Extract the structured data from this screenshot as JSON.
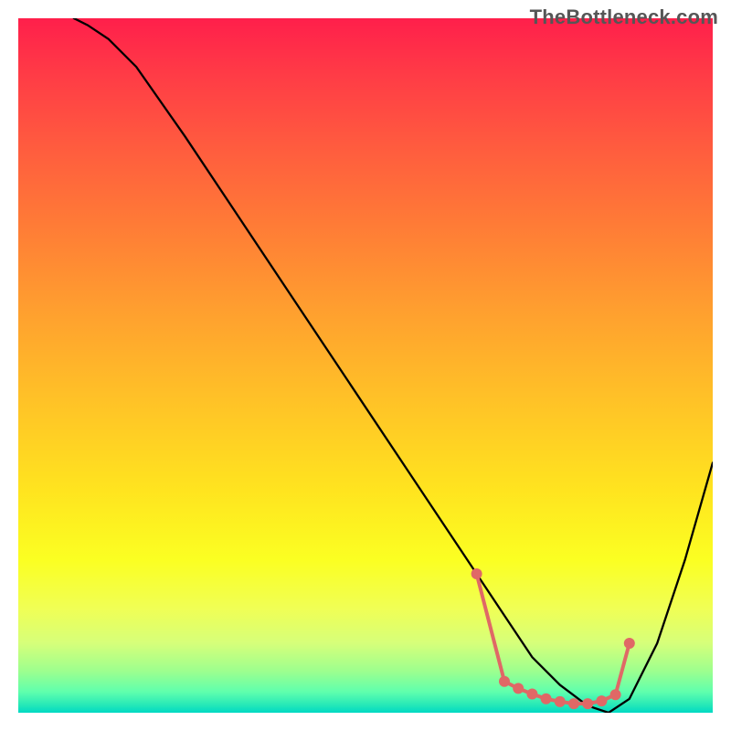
{
  "watermark": "TheBottleneck.com",
  "chart_data": {
    "type": "line",
    "title": "",
    "xlabel": "",
    "ylabel": "",
    "xlim": [
      0,
      100
    ],
    "ylim": [
      0,
      100
    ],
    "gradient_stops": [
      {
        "pos": 0,
        "color": "#ff1f4b"
      },
      {
        "pos": 8,
        "color": "#ff3b46"
      },
      {
        "pos": 18,
        "color": "#ff5a3f"
      },
      {
        "pos": 30,
        "color": "#ff7c36"
      },
      {
        "pos": 42,
        "color": "#ff9f2f"
      },
      {
        "pos": 55,
        "color": "#ffc227"
      },
      {
        "pos": 68,
        "color": "#ffe41f"
      },
      {
        "pos": 78,
        "color": "#fbff22"
      },
      {
        "pos": 85,
        "color": "#f0ff55"
      },
      {
        "pos": 90,
        "color": "#d6ff7a"
      },
      {
        "pos": 94,
        "color": "#9dff8e"
      },
      {
        "pos": 97,
        "color": "#5fffad"
      },
      {
        "pos": 99,
        "color": "#22e7b8"
      },
      {
        "pos": 100,
        "color": "#00d9c4"
      }
    ],
    "series": [
      {
        "name": "bottleneck-curve",
        "x": [
          8,
          10,
          13,
          17,
          24,
          32,
          40,
          48,
          56,
          62,
          66,
          70,
          74,
          78,
          82,
          85,
          88,
          92,
          96,
          100
        ],
        "y": [
          100,
          99,
          97,
          93,
          83,
          71,
          59,
          47,
          35,
          26,
          20,
          14,
          8,
          4,
          1,
          0,
          2,
          10,
          22,
          36
        ]
      }
    ],
    "highlight_dots": {
      "name": "optimal-range-dots",
      "color": "#e06866",
      "x": [
        66,
        70,
        72,
        74,
        76,
        78,
        80,
        82,
        84,
        86,
        88
      ],
      "y": [
        20,
        4.5,
        3.5,
        2.7,
        2.0,
        1.6,
        1.3,
        1.3,
        1.7,
        2.6,
        10
      ]
    }
  }
}
